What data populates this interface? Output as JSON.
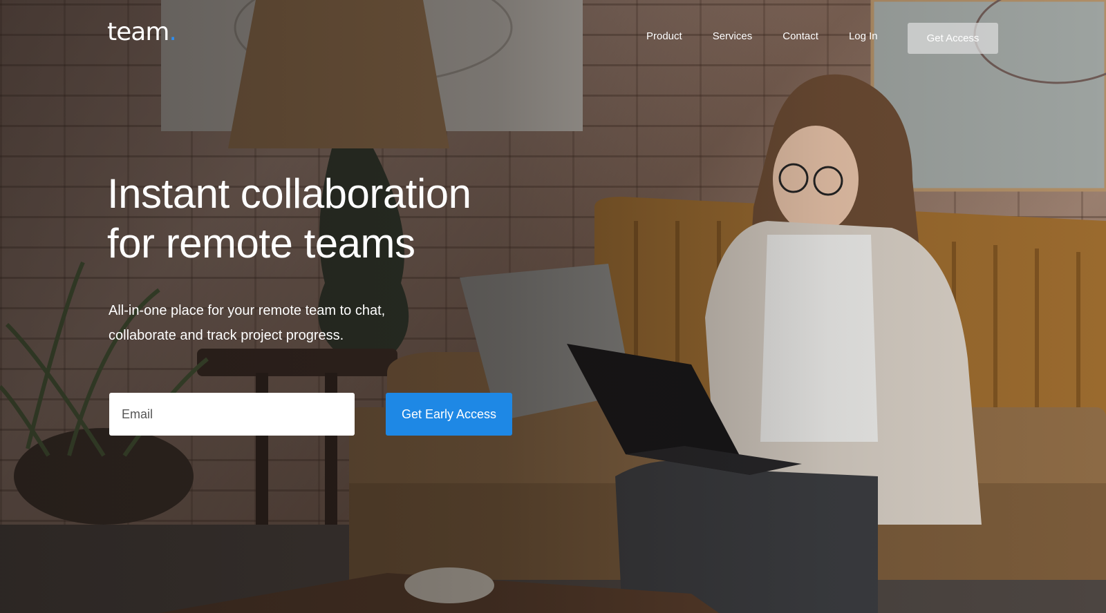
{
  "brand": {
    "name": "team",
    "dot": "."
  },
  "nav": {
    "items": [
      {
        "label": "Product"
      },
      {
        "label": "Services"
      },
      {
        "label": "Contact"
      },
      {
        "label": "Log In"
      }
    ],
    "cta_label": "Get Access"
  },
  "hero": {
    "headline_line1": "Instant collaboration",
    "headline_line2": "for remote teams",
    "subline_line1": "All-in-one place for your remote team to chat,",
    "subline_line2": "collaborate and track project progress.",
    "email_placeholder": "Email",
    "email_value": "",
    "cta_label": "Get Early Access"
  },
  "colors": {
    "accent": "#1e88e5",
    "logo_dot": "#2e8ef0",
    "nav_button": "rgba(220,220,220,.72)"
  }
}
